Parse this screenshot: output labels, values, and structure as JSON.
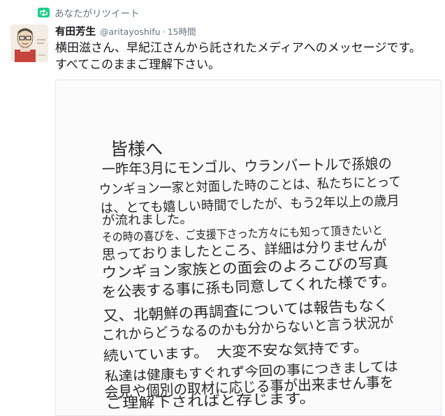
{
  "retweet": {
    "icon": "retweet-icon",
    "label": "あなたがリツイート",
    "accent": "#19cf86"
  },
  "tweet": {
    "author_name": "有田芳生",
    "handle": "@aritayoshifu",
    "separator": "·",
    "time": "15時間",
    "text_lines": [
      "横田滋さん、早紀江さんから託されたメディアへのメッセージです。",
      "すべてこのままご理解下さい。"
    ]
  },
  "letter": {
    "greeting": "皆様へ",
    "lines": [
      "一昨年3月にモンゴル、ウランバートルで孫娘の",
      "ウンギョン一家と対面した時のことは、私たちにとって",
      "は、とても嬉しい時間でしたが、もう2年以上の歳月",
      "が流れました。",
      "その時の喜びを、ご支援下さった方々にも知って頂きたいと",
      "思っておりましたところ、詳細は分りませんが",
      "ウンギョン家族との面会のよろこびの写真",
      "を公表する事に孫も同意してくれた様です。",
      "又、北朝鮮の再調査については報告もなく",
      "これからどうなるのかも分からないと言う状況が",
      "続いています。　大変不安な気持です。",
      "私達は健康もすぐれず今回の事につきましては",
      "会見や個別の取材に応じる事が出来ません事を",
      "ご理解下さればと存じます。"
    ]
  }
}
